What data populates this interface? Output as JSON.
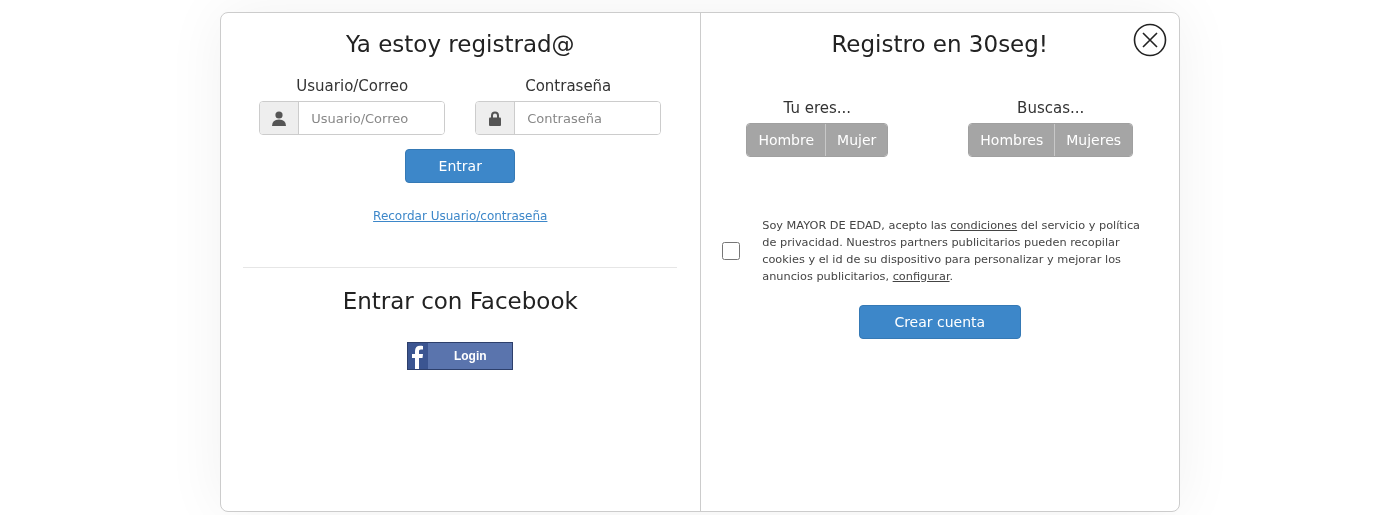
{
  "login": {
    "title": "Ya estoy registrad@",
    "fields": [
      {
        "kind": "user",
        "label": "Usuario/Correo",
        "placeholder": "Usuario/Correo"
      },
      {
        "kind": "lock",
        "label": "Contraseña",
        "placeholder": "Contraseña"
      }
    ],
    "submit": "Entrar",
    "forgot": "Recordar Usuario/contraseña"
  },
  "facebook": {
    "title": "Entrar con Facebook",
    "button": "Login"
  },
  "register": {
    "title": "Registro en 30seg!",
    "groups": [
      {
        "label": "Tu eres...",
        "options": [
          {
            "label": "Hombre",
            "selected": false
          },
          {
            "label": "Mujer",
            "selected": false
          }
        ]
      },
      {
        "label": "Buscas...",
        "options": [
          {
            "label": "Hombres",
            "selected": false
          },
          {
            "label": "Mujeres",
            "selected": false
          }
        ]
      }
    ],
    "consent": {
      "checked": false,
      "parts": [
        {
          "kind": "text",
          "text": "Soy MAYOR DE EDAD, acepto las "
        },
        {
          "kind": "link",
          "text": "condiciones"
        },
        {
          "kind": "text",
          "text": " del servicio y política de privacidad. Nuestros partners publicitarios pueden recopilar cookies y el id de su dispositivo para personalizar y mejorar los anuncios publicitarios, "
        },
        {
          "kind": "link",
          "text": "configurar"
        },
        {
          "kind": "text",
          "text": "."
        }
      ]
    },
    "submit": "Crear cuenta"
  }
}
